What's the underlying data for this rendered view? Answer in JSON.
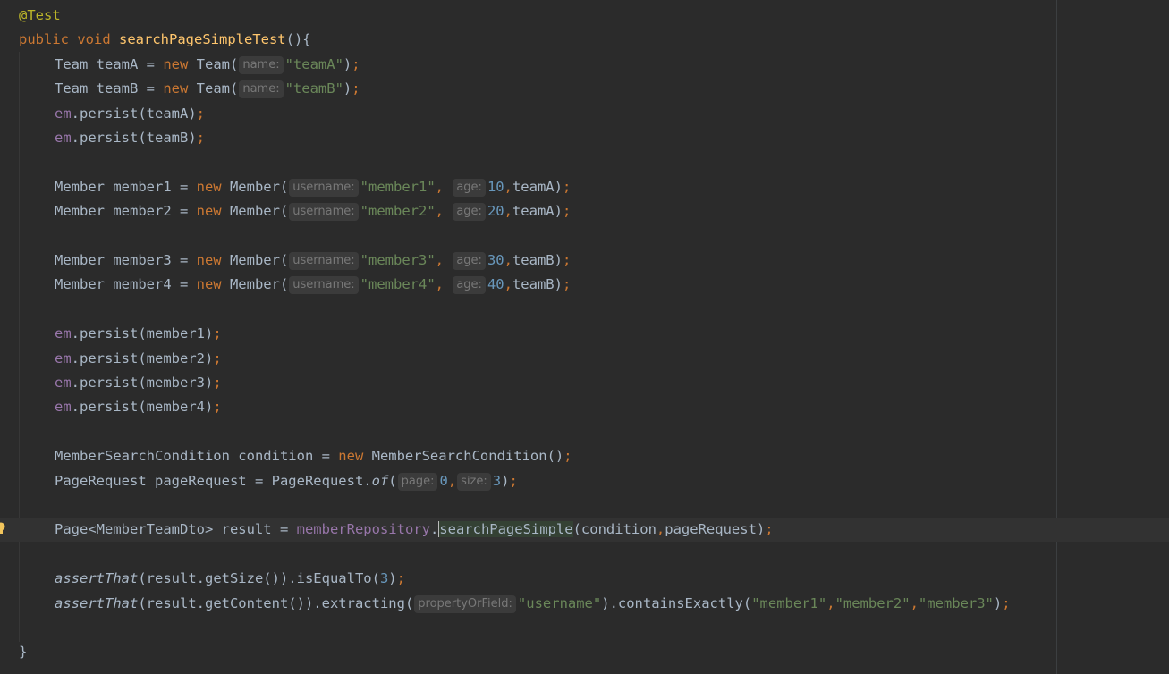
{
  "editor": {
    "lines": [
      {
        "indent": 0,
        "tokens": [
          {
            "t": "@Test",
            "c": "annotation"
          }
        ]
      },
      {
        "indent": 0,
        "tokens": [
          {
            "t": "public ",
            "c": "kw"
          },
          {
            "t": "void ",
            "c": "kw"
          },
          {
            "t": "searchPageSimpleTest",
            "c": "method-decl"
          },
          {
            "t": "(){",
            "c": "plain"
          }
        ]
      },
      {
        "indent": 1,
        "tokens": [
          {
            "t": "Team teamA = ",
            "c": "plain"
          },
          {
            "t": "new ",
            "c": "kw"
          },
          {
            "t": "Team(",
            "c": "plain"
          },
          {
            "hint": "name:"
          },
          {
            "t": "\"teamA\"",
            "c": "str"
          },
          {
            "t": ")",
            "c": "plain"
          },
          {
            "t": ";",
            "c": "semi"
          }
        ]
      },
      {
        "indent": 1,
        "tokens": [
          {
            "t": "Team teamB = ",
            "c": "plain"
          },
          {
            "t": "new ",
            "c": "kw"
          },
          {
            "t": "Team(",
            "c": "plain"
          },
          {
            "hint": "name:"
          },
          {
            "t": "\"teamB\"",
            "c": "str"
          },
          {
            "t": ")",
            "c": "plain"
          },
          {
            "t": ";",
            "c": "semi"
          }
        ]
      },
      {
        "indent": 1,
        "tokens": [
          {
            "t": "em",
            "c": "field"
          },
          {
            "t": ".persist(teamA)",
            "c": "plain"
          },
          {
            "t": ";",
            "c": "semi"
          }
        ]
      },
      {
        "indent": 1,
        "tokens": [
          {
            "t": "em",
            "c": "field"
          },
          {
            "t": ".persist(teamB)",
            "c": "plain"
          },
          {
            "t": ";",
            "c": "semi"
          }
        ]
      },
      {
        "indent": 1,
        "tokens": []
      },
      {
        "indent": 1,
        "tokens": [
          {
            "t": "Member member1 = ",
            "c": "plain"
          },
          {
            "t": "new ",
            "c": "kw"
          },
          {
            "t": "Member(",
            "c": "plain"
          },
          {
            "hint": "username:"
          },
          {
            "t": "\"member1\"",
            "c": "str"
          },
          {
            "t": ", ",
            "c": "semi"
          },
          {
            "hint": "age:"
          },
          {
            "t": "10",
            "c": "num"
          },
          {
            "t": ",",
            "c": "semi"
          },
          {
            "t": "teamA)",
            "c": "plain"
          },
          {
            "t": ";",
            "c": "semi"
          }
        ]
      },
      {
        "indent": 1,
        "tokens": [
          {
            "t": "Member member2 = ",
            "c": "plain"
          },
          {
            "t": "new ",
            "c": "kw"
          },
          {
            "t": "Member(",
            "c": "plain"
          },
          {
            "hint": "username:"
          },
          {
            "t": "\"member2\"",
            "c": "str"
          },
          {
            "t": ", ",
            "c": "semi"
          },
          {
            "hint": "age:"
          },
          {
            "t": "20",
            "c": "num"
          },
          {
            "t": ",",
            "c": "semi"
          },
          {
            "t": "teamA)",
            "c": "plain"
          },
          {
            "t": ";",
            "c": "semi"
          }
        ]
      },
      {
        "indent": 1,
        "tokens": []
      },
      {
        "indent": 1,
        "tokens": [
          {
            "t": "Member member3 = ",
            "c": "plain"
          },
          {
            "t": "new ",
            "c": "kw"
          },
          {
            "t": "Member(",
            "c": "plain"
          },
          {
            "hint": "username:"
          },
          {
            "t": "\"member3\"",
            "c": "str"
          },
          {
            "t": ", ",
            "c": "semi"
          },
          {
            "hint": "age:"
          },
          {
            "t": "30",
            "c": "num"
          },
          {
            "t": ",",
            "c": "semi"
          },
          {
            "t": "teamB)",
            "c": "plain"
          },
          {
            "t": ";",
            "c": "semi"
          }
        ]
      },
      {
        "indent": 1,
        "tokens": [
          {
            "t": "Member member4 = ",
            "c": "plain"
          },
          {
            "t": "new ",
            "c": "kw"
          },
          {
            "t": "Member(",
            "c": "plain"
          },
          {
            "hint": "username:"
          },
          {
            "t": "\"member4\"",
            "c": "str"
          },
          {
            "t": ", ",
            "c": "semi"
          },
          {
            "hint": "age:"
          },
          {
            "t": "40",
            "c": "num"
          },
          {
            "t": ",",
            "c": "semi"
          },
          {
            "t": "teamB)",
            "c": "plain"
          },
          {
            "t": ";",
            "c": "semi"
          }
        ]
      },
      {
        "indent": 1,
        "tokens": []
      },
      {
        "indent": 1,
        "tokens": [
          {
            "t": "em",
            "c": "field"
          },
          {
            "t": ".persist(member1)",
            "c": "plain"
          },
          {
            "t": ";",
            "c": "semi"
          }
        ]
      },
      {
        "indent": 1,
        "tokens": [
          {
            "t": "em",
            "c": "field"
          },
          {
            "t": ".persist(member2)",
            "c": "plain"
          },
          {
            "t": ";",
            "c": "semi"
          }
        ]
      },
      {
        "indent": 1,
        "tokens": [
          {
            "t": "em",
            "c": "field"
          },
          {
            "t": ".persist(member3)",
            "c": "plain"
          },
          {
            "t": ";",
            "c": "semi"
          }
        ]
      },
      {
        "indent": 1,
        "tokens": [
          {
            "t": "em",
            "c": "field"
          },
          {
            "t": ".persist(member4)",
            "c": "plain"
          },
          {
            "t": ";",
            "c": "semi"
          }
        ]
      },
      {
        "indent": 1,
        "tokens": []
      },
      {
        "indent": 1,
        "tokens": [
          {
            "t": "MemberSearchCondition condition = ",
            "c": "plain"
          },
          {
            "t": "new ",
            "c": "kw"
          },
          {
            "t": "MemberSearchCondition()",
            "c": "plain"
          },
          {
            "t": ";",
            "c": "semi"
          }
        ]
      },
      {
        "indent": 1,
        "tokens": [
          {
            "t": "PageRequest pageRequest = PageRequest.",
            "c": "plain"
          },
          {
            "t": "of",
            "c": "static"
          },
          {
            "t": "(",
            "c": "plain"
          },
          {
            "hint": "page:"
          },
          {
            "t": "0",
            "c": "num"
          },
          {
            "t": ",",
            "c": "semi"
          },
          {
            "hint": "size:"
          },
          {
            "t": "3",
            "c": "num"
          },
          {
            "t": ")",
            "c": "plain"
          },
          {
            "t": ";",
            "c": "semi"
          }
        ]
      },
      {
        "indent": 1,
        "tokens": []
      },
      {
        "indent": 1,
        "current": true,
        "bulb": true,
        "tokens": [
          {
            "t": "Page<MemberTeamDto> result = ",
            "c": "plain"
          },
          {
            "t": "memberRepository",
            "c": "field"
          },
          {
            "t": ".",
            "c": "plain"
          },
          {
            "t": "searchPageSimple",
            "c": "plain",
            "hl": true
          },
          {
            "t": "(condition",
            "c": "plain"
          },
          {
            "t": ",",
            "c": "semi"
          },
          {
            "t": "pageRequest)",
            "c": "plain"
          },
          {
            "t": ";",
            "c": "semi"
          }
        ]
      },
      {
        "indent": 1,
        "tokens": []
      },
      {
        "indent": 1,
        "tokens": [
          {
            "t": "assertThat",
            "c": "static"
          },
          {
            "t": "(result.getSize()).isEqualTo(",
            "c": "plain"
          },
          {
            "t": "3",
            "c": "num"
          },
          {
            "t": ")",
            "c": "plain"
          },
          {
            "t": ";",
            "c": "semi"
          }
        ]
      },
      {
        "indent": 1,
        "tokens": [
          {
            "t": "assertThat",
            "c": "static"
          },
          {
            "t": "(result.getContent()).extracting(",
            "c": "plain"
          },
          {
            "hint": "propertyOrField:"
          },
          {
            "t": "\"username\"",
            "c": "str"
          },
          {
            "t": ").containsExactly(",
            "c": "plain"
          },
          {
            "t": "\"member1\"",
            "c": "str"
          },
          {
            "t": ",",
            "c": "semi"
          },
          {
            "t": "\"member2\"",
            "c": "str"
          },
          {
            "t": ",",
            "c": "semi"
          },
          {
            "t": "\"member3\"",
            "c": "str"
          },
          {
            "t": ")",
            "c": "plain"
          },
          {
            "t": ";",
            "c": "semi"
          }
        ]
      },
      {
        "indent": 1,
        "tokens": []
      },
      {
        "indent": 0,
        "tokens": [
          {
            "t": "}",
            "c": "plain"
          }
        ]
      }
    ]
  },
  "colors": {
    "background": "#2b2b2b",
    "keyword": "#cc7832",
    "string": "#6a8759",
    "number": "#6897bb",
    "field": "#9876aa",
    "method_declaration": "#ffc66d",
    "annotation": "#bbb529",
    "default_text": "#a9b7c6",
    "bulb": "#f2c55c"
  },
  "icons": {
    "bulb": "lightbulb-icon"
  }
}
